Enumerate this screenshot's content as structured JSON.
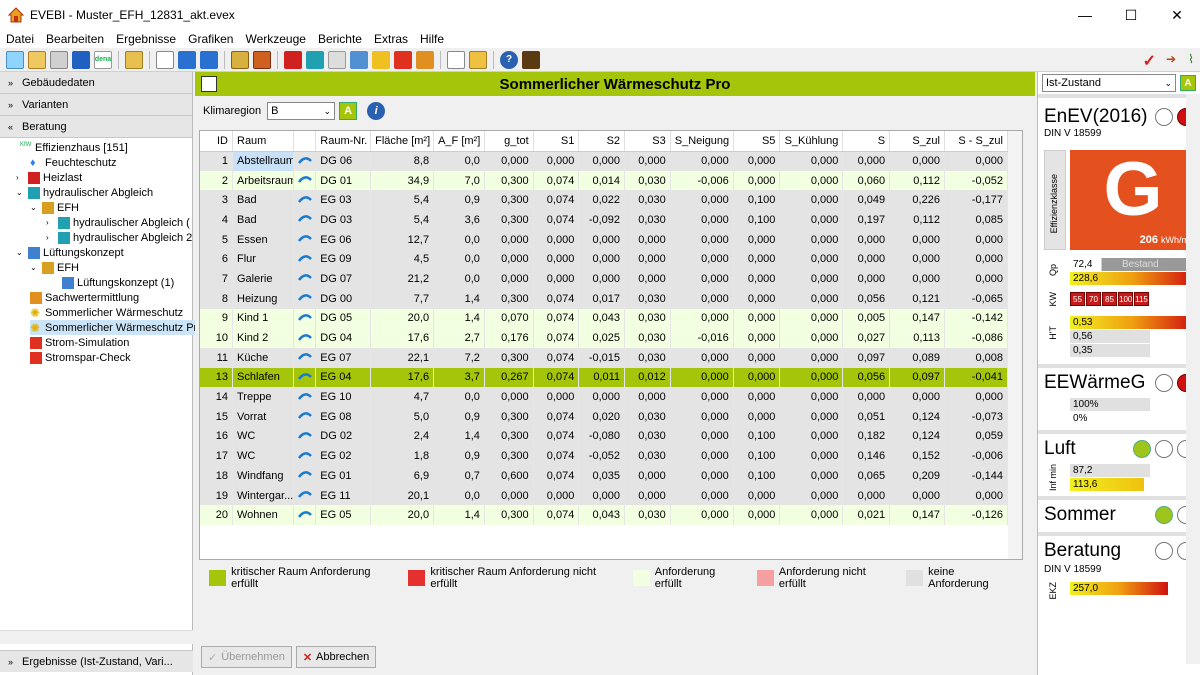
{
  "window": {
    "title": "EVEBI - Muster_EFH_12831_akt.evex",
    "minimize": "—",
    "maximize": "☐",
    "close": "✕"
  },
  "menu": [
    "Datei",
    "Bearbeiten",
    "Ergebnisse",
    "Grafiken",
    "Werkzeuge",
    "Berichte",
    "Extras",
    "Hilfe"
  ],
  "left": {
    "sections": [
      "Gebäudedaten",
      "Varianten",
      "Beratung"
    ],
    "tree": [
      {
        "label": "Effizienzhaus [151]",
        "icon": "kfw-icon"
      },
      {
        "label": "Feuchteschutz",
        "icon": "drop-icon"
      },
      {
        "label": "Heizlast",
        "icon": "heizlast-icon"
      },
      {
        "label": "hydraulischer Abgleich",
        "icon": "hydraulic-icon"
      },
      {
        "label": "EFH",
        "icon": "house-icon"
      },
      {
        "label": "hydraulischer Abgleich (",
        "icon": "hydraulic-icon"
      },
      {
        "label": "hydraulischer Abgleich 2",
        "icon": "hydraulic-icon"
      },
      {
        "label": "Lüftungskonzept",
        "icon": "fan-icon"
      },
      {
        "label": "EFH",
        "icon": "house-icon"
      },
      {
        "label": "Lüftungskonzept (1)",
        "icon": "fan-icon"
      },
      {
        "label": "Sachwertermittlung",
        "icon": "money-icon"
      },
      {
        "label": "Sommerlicher Wärmeschutz",
        "icon": "sun-icon"
      },
      {
        "label": "Sommerlicher Wärmeschutz Pro",
        "icon": "sun-icon"
      },
      {
        "label": "Strom-Simulation",
        "icon": "power-icon"
      },
      {
        "label": "Stromspar-Check",
        "icon": "power-icon"
      }
    ],
    "bottom": "Ergebnisse (Ist-Zustand, Vari..."
  },
  "main": {
    "title": "Sommerlicher Wärmeschutz Pro",
    "klima_label": "Klimaregion",
    "klima_value": "B",
    "columns": [
      "ID",
      "Raum",
      "",
      "Raum-Nr.",
      "Fläche [m²]",
      "A_F [m²]",
      "g_tot",
      "S1",
      "S2",
      "S3",
      "S_Neigung",
      "S5",
      "S_Kühlung",
      "S",
      "S_zul",
      "S - S_zul"
    ],
    "rows": [
      {
        "status": "gr",
        "cells": [
          "1",
          "Abstellraum",
          "DG 06",
          "8,8",
          "0,0",
          "0,000",
          "0,000",
          "0,000",
          "0,000",
          "0,000",
          "0,000",
          "0,000",
          "0,000",
          "0,000",
          "0,000"
        ]
      },
      {
        "status": "lg",
        "cells": [
          "2",
          "Arbeitsraum",
          "DG 01",
          "34,9",
          "7,0",
          "0,300",
          "0,074",
          "0,014",
          "0,030",
          "-0,006",
          "0,000",
          "0,000",
          "0,060",
          "0,112",
          "-0,052"
        ]
      },
      {
        "status": "gr",
        "cells": [
          "3",
          "Bad",
          "EG 03",
          "5,4",
          "0,9",
          "0,300",
          "0,074",
          "0,022",
          "0,030",
          "0,000",
          "0,100",
          "0,000",
          "0,049",
          "0,226",
          "-0,177"
        ]
      },
      {
        "status": "gr",
        "cells": [
          "4",
          "Bad",
          "DG 03",
          "5,4",
          "3,6",
          "0,300",
          "0,074",
          "-0,092",
          "0,030",
          "0,000",
          "0,100",
          "0,000",
          "0,197",
          "0,112",
          "0,085"
        ]
      },
      {
        "status": "gr",
        "cells": [
          "5",
          "Essen",
          "EG 06",
          "12,7",
          "0,0",
          "0,000",
          "0,000",
          "0,000",
          "0,000",
          "0,000",
          "0,000",
          "0,000",
          "0,000",
          "0,000",
          "0,000"
        ]
      },
      {
        "status": "gr",
        "cells": [
          "6",
          "Flur",
          "EG 09",
          "4,5",
          "0,0",
          "0,000",
          "0,000",
          "0,000",
          "0,000",
          "0,000",
          "0,000",
          "0,000",
          "0,000",
          "0,000",
          "0,000"
        ]
      },
      {
        "status": "gr",
        "cells": [
          "7",
          "Galerie",
          "DG 07",
          "21,2",
          "0,0",
          "0,000",
          "0,000",
          "0,000",
          "0,000",
          "0,000",
          "0,000",
          "0,000",
          "0,000",
          "0,000",
          "0,000"
        ]
      },
      {
        "status": "gr",
        "cells": [
          "8",
          "Heizung",
          "DG 00",
          "7,7",
          "1,4",
          "0,300",
          "0,074",
          "0,017",
          "0,030",
          "0,000",
          "0,000",
          "0,000",
          "0,056",
          "0,121",
          "-0,065"
        ]
      },
      {
        "status": "lg",
        "cells": [
          "9",
          "Kind 1",
          "DG 05",
          "20,0",
          "1,4",
          "0,070",
          "0,074",
          "0,043",
          "0,030",
          "0,000",
          "0,000",
          "0,000",
          "0,005",
          "0,147",
          "-0,142"
        ]
      },
      {
        "status": "lg",
        "cells": [
          "10",
          "Kind 2",
          "DG 04",
          "17,6",
          "2,7",
          "0,176",
          "0,074",
          "0,025",
          "0,030",
          "-0,016",
          "0,000",
          "0,000",
          "0,027",
          "0,113",
          "-0,086"
        ]
      },
      {
        "status": "gr",
        "cells": [
          "11",
          "Küche",
          "EG 07",
          "22,1",
          "7,2",
          "0,300",
          "0,074",
          "-0,015",
          "0,030",
          "0,000",
          "0,000",
          "0,000",
          "0,097",
          "0,089",
          "0,008"
        ]
      },
      {
        "status": "sel",
        "cells": [
          "13",
          "Schlafen",
          "EG 04",
          "17,6",
          "3,7",
          "0,267",
          "0,074",
          "0,011",
          "0,012",
          "0,000",
          "0,000",
          "0,000",
          "0,056",
          "0,097",
          "-0,041"
        ]
      },
      {
        "status": "gr",
        "cells": [
          "14",
          "Treppe",
          "EG 10",
          "4,7",
          "0,0",
          "0,000",
          "0,000",
          "0,000",
          "0,000",
          "0,000",
          "0,000",
          "0,000",
          "0,000",
          "0,000",
          "0,000"
        ]
      },
      {
        "status": "gr",
        "cells": [
          "15",
          "Vorrat",
          "EG 08",
          "5,0",
          "0,9",
          "0,300",
          "0,074",
          "0,020",
          "0,030",
          "0,000",
          "0,000",
          "0,000",
          "0,051",
          "0,124",
          "-0,073"
        ]
      },
      {
        "status": "gr",
        "cells": [
          "16",
          "WC",
          "DG 02",
          "2,4",
          "1,4",
          "0,300",
          "0,074",
          "-0,080",
          "0,030",
          "0,000",
          "0,100",
          "0,000",
          "0,182",
          "0,124",
          "0,059"
        ]
      },
      {
        "status": "gr",
        "cells": [
          "17",
          "WC",
          "EG 02",
          "1,8",
          "0,9",
          "0,300",
          "0,074",
          "-0,052",
          "0,030",
          "0,000",
          "0,100",
          "0,000",
          "0,146",
          "0,152",
          "-0,006"
        ]
      },
      {
        "status": "gr",
        "cells": [
          "18",
          "Windfang",
          "EG 01",
          "6,9",
          "0,7",
          "0,600",
          "0,074",
          "0,035",
          "0,000",
          "0,000",
          "0,100",
          "0,000",
          "0,065",
          "0,209",
          "-0,144"
        ]
      },
      {
        "status": "gr",
        "cells": [
          "19",
          "Wintergar...",
          "EG 11",
          "20,1",
          "0,0",
          "0,000",
          "0,000",
          "0,000",
          "0,000",
          "0,000",
          "0,000",
          "0,000",
          "0,000",
          "0,000",
          "0,000"
        ]
      },
      {
        "status": "lg",
        "cells": [
          "20",
          "Wohnen",
          "EG 05",
          "20,0",
          "1,4",
          "0,300",
          "0,074",
          "0,043",
          "0,030",
          "0,000",
          "0,000",
          "0,000",
          "0,021",
          "0,147",
          "-0,126"
        ]
      }
    ],
    "legend": [
      {
        "label": "kritischer Raum Anforderung erfüllt",
        "color": "#a5c50a"
      },
      {
        "label": "kritischer Raum Anforderung nicht erfüllt",
        "color": "#e53030"
      },
      {
        "label": "Anforderung erfüllt",
        "color": "#f2ffe0"
      },
      {
        "label": "Anforderung nicht erfüllt",
        "color": "#f4a0a0"
      },
      {
        "label": "keine Anforderung",
        "color": "#e0e0e0"
      }
    ],
    "btn_accept": "Übernehmen",
    "btn_cancel": "Abbrechen"
  },
  "right": {
    "state": "Ist-Zustand",
    "enev": {
      "title": "EnEV(2016)",
      "norm": "DIN V 18599",
      "class_label": "Effizienzklasse",
      "class": "G",
      "value": "206",
      "unit": "kWh/m²"
    },
    "qp": {
      "label": "Qp",
      "v1": "72,4",
      "v1_tag": "Bestand",
      "v2": "228,6"
    },
    "kw": {
      "label": "KW",
      "values": [
        "55",
        "70",
        "85",
        "100",
        "115"
      ]
    },
    "ht": {
      "label": "H'T",
      "values": [
        "0,53",
        "0,56",
        "0,35"
      ]
    },
    "ee": {
      "title": "EEWärmeG",
      "v1": "100%",
      "v2": "0%"
    },
    "luft": {
      "title": "Luft",
      "label": "Inf min",
      "v1": "87,2",
      "v2": "113,6"
    },
    "sommer": {
      "title": "Sommer"
    },
    "beratung": {
      "title": "Beratung",
      "norm": "DIN V 18599",
      "label": "EKZ",
      "v1": "257,0"
    }
  }
}
